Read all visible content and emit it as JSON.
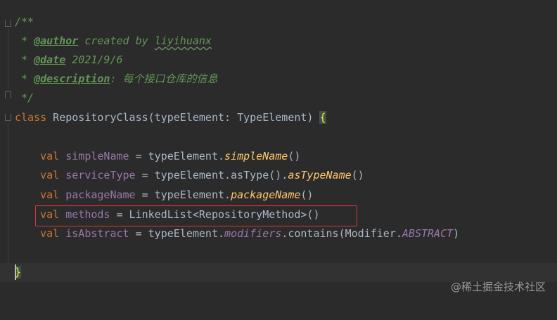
{
  "code": {
    "doc_open": "/**",
    "author_prefix": " * ",
    "author_tag": "@author",
    "author_text": " created by ",
    "author_name": "liyihuanx",
    "date_prefix": " * ",
    "date_tag": "@date",
    "date_text": " 2021/9/6",
    "desc_prefix": " * ",
    "desc_tag": "@description",
    "desc_colon": ": ",
    "desc_text": "每个接口仓库的信息",
    "doc_close": " */",
    "class_kw": "class",
    "class_sig": " RepositoryClass(typeElement: TypeElement) ",
    "open_brace": "{",
    "close_brace": "}",
    "members": [
      {
        "kw": "val",
        "name": "simpleName",
        "mid": " = typeElement.",
        "call": "simpleName",
        "tail": "()",
        "call_style": "ext"
      },
      {
        "kw": "val",
        "name": "serviceType",
        "mid": " = typeElement.asType().",
        "call": "asTypeName",
        "tail": "()",
        "call_style": "ext"
      },
      {
        "kw": "val",
        "name": "packageName",
        "mid": " = typeElement.",
        "call": "packageName",
        "tail": "()",
        "call_style": "ext"
      },
      {
        "kw": "val",
        "name": "methods",
        "mid": " = LinkedList<RepositoryMethod>()",
        "call": "",
        "tail": "",
        "call_style": "none"
      },
      {
        "kw": "val",
        "name": "isAbstract",
        "mid": " = typeElement.",
        "call": "modifiers",
        "tail": ".contains(Modifier.",
        "tail2": "ABSTRACT",
        "tail3": ")",
        "call_style": "static"
      }
    ]
  },
  "watermark": "@稀土掘金技术社区",
  "colors": {
    "background": "#2b2b2b",
    "keyword": "#cc7832",
    "property": "#9876aa",
    "extension_call": "#ffc66d",
    "doc_comment": "#629755",
    "default_text": "#a9b7c6",
    "annotation_box": "#d7373d"
  }
}
